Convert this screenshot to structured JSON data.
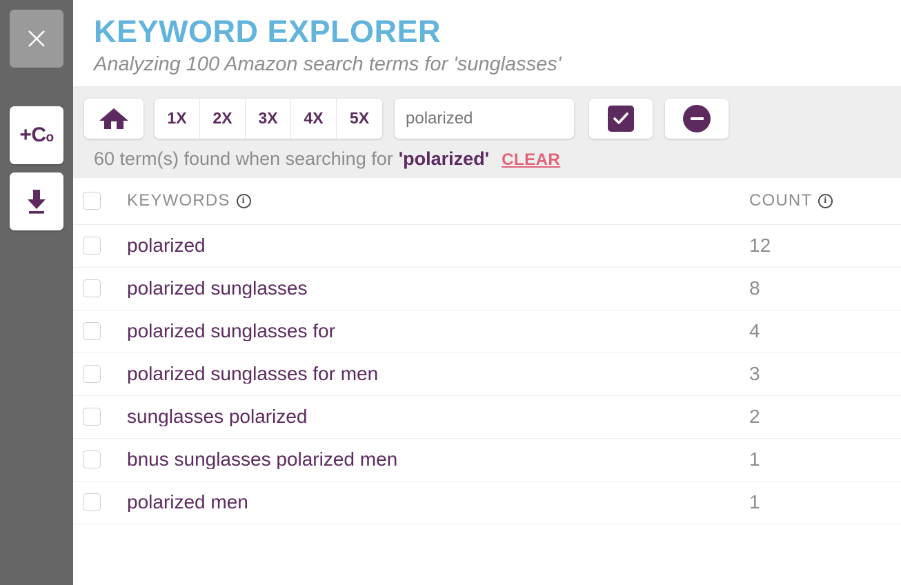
{
  "sidebar": {
    "close_button": {
      "icon": "close-icon",
      "label": ""
    },
    "add_column_button": {
      "icon": "add-column-icon",
      "label_main": "+C",
      "label_sub": "o"
    },
    "download_button": {
      "icon": "download-icon",
      "label": ""
    }
  },
  "header": {
    "title": "KEYWORD EXPLORER",
    "subtitle": "Analyzing 100 Amazon search terms for 'sunglasses'"
  },
  "toolbar": {
    "home_button": {
      "icon": "home-icon",
      "label": ""
    },
    "multiplier_buttons": [
      {
        "label": "1X"
      },
      {
        "label": "2X"
      },
      {
        "label": "3X"
      },
      {
        "label": "4X"
      },
      {
        "label": "5X"
      }
    ],
    "search": {
      "value": "polarized",
      "placeholder": "polarized"
    },
    "confirm_button": {
      "icon": "checkbox-checked-icon",
      "label": ""
    },
    "remove_button": {
      "icon": "minus-circle-icon",
      "label": ""
    }
  },
  "results": {
    "prefix": "60 term(s) found when searching for",
    "term": "'polarized'",
    "clear_label": "CLEAR"
  },
  "table": {
    "columns": {
      "keywords_label": "KEYWORDS",
      "count_label": "COUNT",
      "info_glyph": "i"
    },
    "rows": [
      {
        "keyword": "polarized",
        "count": "12"
      },
      {
        "keyword": "polarized sunglasses",
        "count": "8"
      },
      {
        "keyword": "polarized sunglasses for",
        "count": "4"
      },
      {
        "keyword": "polarized sunglasses for men",
        "count": "3"
      },
      {
        "keyword": "sunglasses polarized",
        "count": "2"
      },
      {
        "keyword": "bnus sunglasses polarized men",
        "count": "1"
      },
      {
        "keyword": "polarized men",
        "count": "1"
      }
    ]
  },
  "colors": {
    "accent_purple": "#5c2a5e",
    "title_blue": "#62b4dc",
    "clear_red": "#e2647a",
    "sidebar_gray": "#666666",
    "toolbar_gray": "#eeeeee",
    "muted_text": "#8d8d8d"
  }
}
